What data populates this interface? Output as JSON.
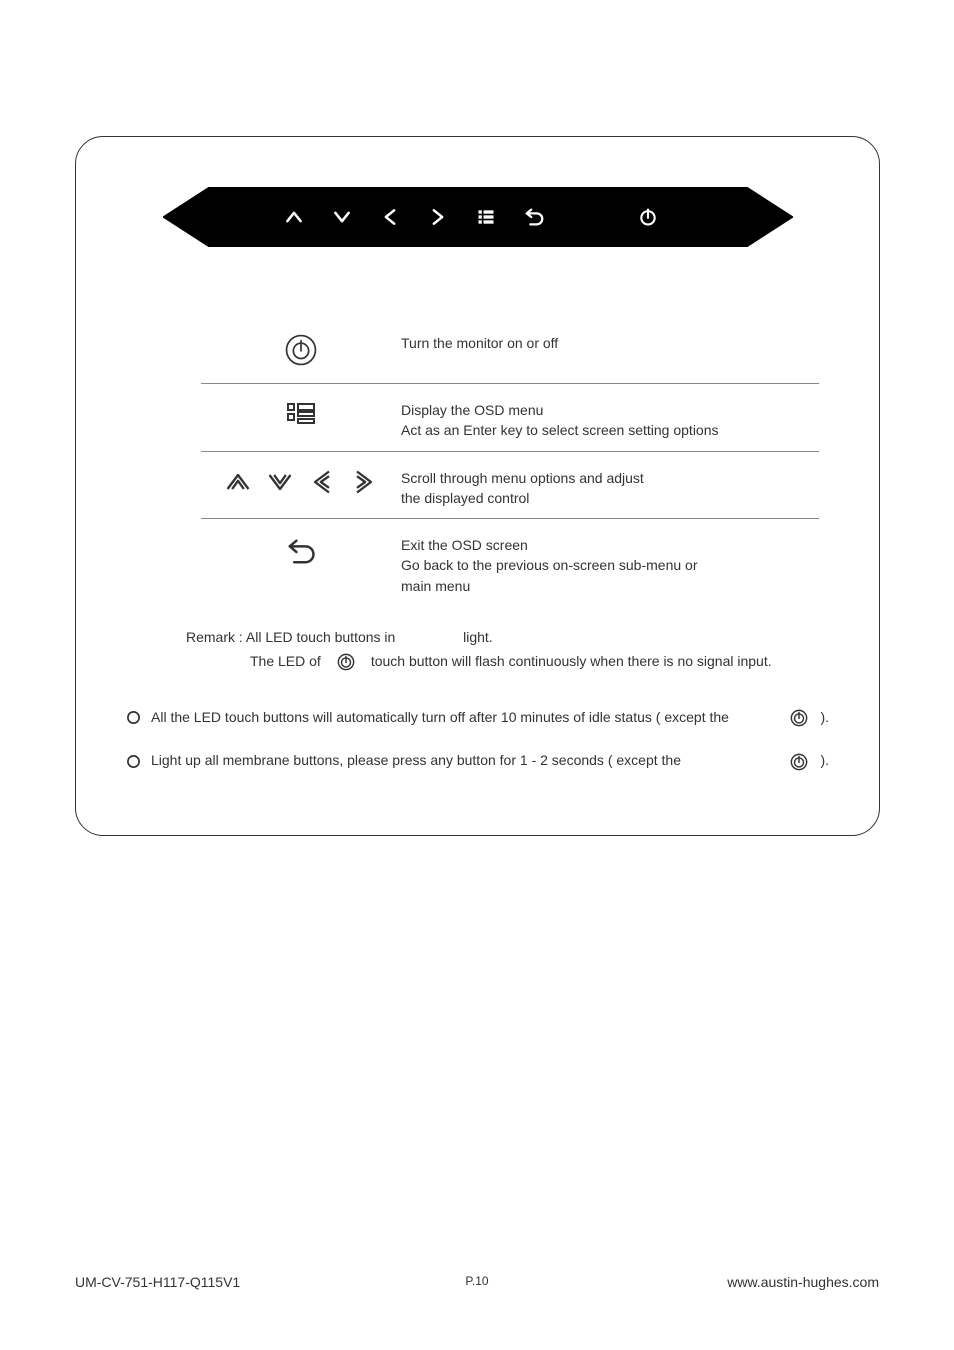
{
  "table": {
    "power": "Turn the monitor on or off",
    "menu_line1": "Display the OSD menu",
    "menu_line2": "Act as an Enter key to select screen setting options",
    "arrows_line1": "Scroll through menu options and adjust",
    "arrows_line2": "the displayed control",
    "back_line1": "Exit the OSD screen",
    "back_line2": "Go back to the previous on-screen sub-menu or",
    "back_line3": "main menu"
  },
  "remark": {
    "line1a": "Remark : All LED touch buttons in",
    "line1b": "light.",
    "line2a": "The LED of",
    "line2b": "touch button will flash continuously when there is no signal input."
  },
  "notes": {
    "note1": "All the LED touch buttons will automatically turn off after 10 minutes of idle status ( except the",
    "note1_suffix": ").",
    "note2": "Light up all membrane buttons, please press any button for 1 - 2 seconds ( except the",
    "note2_suffix": ")."
  },
  "footer": {
    "left": "UM-CV-751-H117-Q115V1",
    "center": "P.10",
    "right": "www.austin-hughes.com"
  }
}
